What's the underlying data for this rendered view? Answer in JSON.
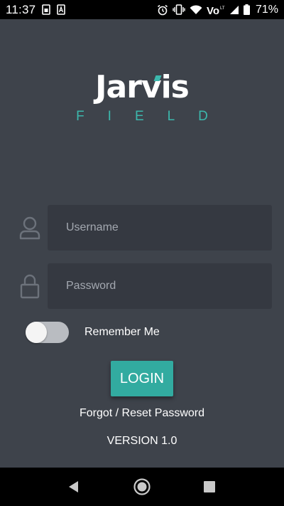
{
  "status_bar": {
    "time": "11:37",
    "network_label": "Vo LTE",
    "battery_percent": "71%",
    "icons": [
      "sim-card-icon",
      "notification-a-icon",
      "alarm-icon",
      "vibrate-icon",
      "wifi-icon",
      "volte-icon",
      "signal-icon",
      "battery-icon"
    ]
  },
  "logo": {
    "title": "Jarvis",
    "subtitle": "FIELD"
  },
  "form": {
    "username_placeholder": "Username",
    "username_value": "",
    "password_placeholder": "Password",
    "password_value": "",
    "remember_label": "Remember Me",
    "remember_checked": false,
    "login_label": "LOGIN",
    "forgot_label": "Forgot / Reset Password"
  },
  "footer": {
    "version": "VERSION 1.0"
  },
  "nav_bar": {
    "icons": [
      "back-icon",
      "home-icon",
      "recents-icon"
    ]
  },
  "colors": {
    "background": "#3e434b",
    "field_background": "#353941",
    "accent": "#32aba0",
    "toggle_track": "#b9bcc1"
  }
}
